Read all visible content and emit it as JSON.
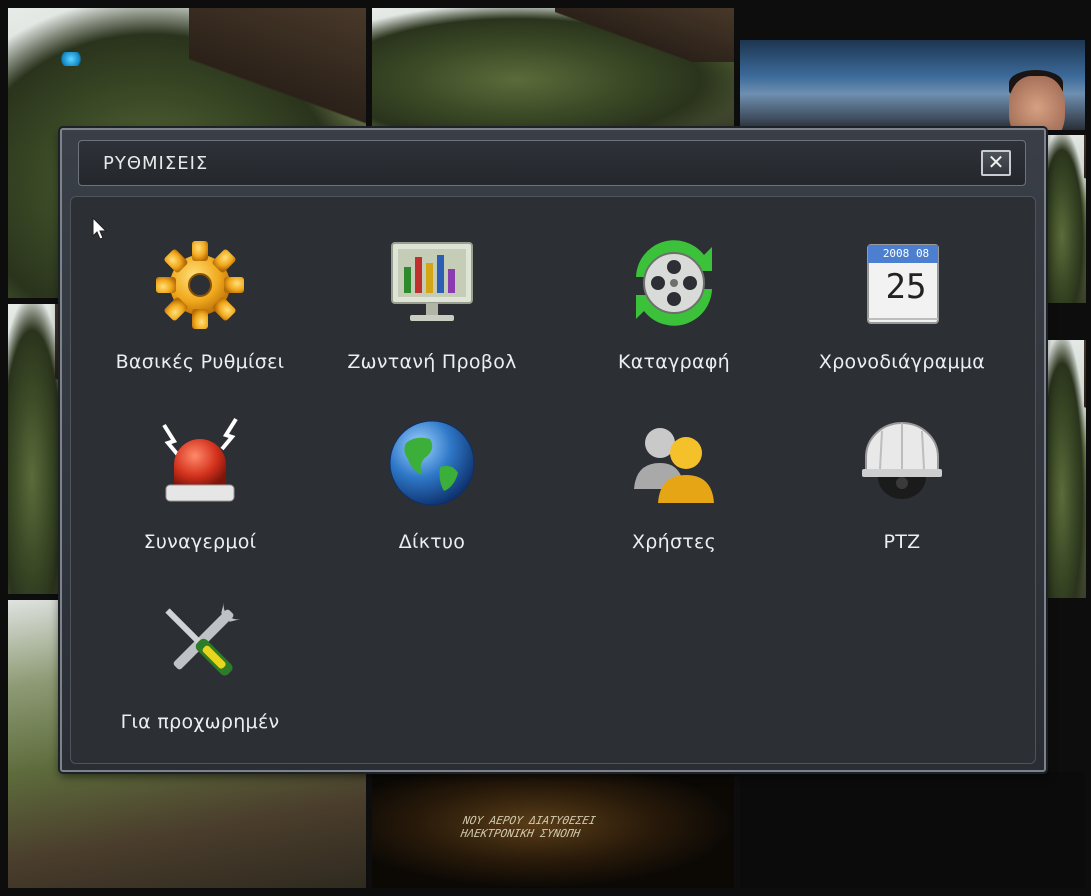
{
  "dialog": {
    "title": "ΡΥΘΜΙΣΕΙΣ",
    "close_label": "✕"
  },
  "menu": {
    "items": [
      {
        "label": "Βασικές Ρυθμίσει",
        "icon": "gear-icon"
      },
      {
        "label": "Ζωντανή Προβολ",
        "icon": "monitor-icon"
      },
      {
        "label": "Καταγραφή",
        "icon": "film-reel-icon"
      },
      {
        "label": "Χρονοδιάγραμμα",
        "icon": "calendar-icon"
      },
      {
        "label": "Συναγερμοί",
        "icon": "alarm-siren-icon"
      },
      {
        "label": "Δίκτυο",
        "icon": "globe-icon"
      },
      {
        "label": "Χρήστες",
        "icon": "users-icon"
      },
      {
        "label": "PTZ",
        "icon": "dome-camera-icon"
      },
      {
        "label": "Για προχωρημέν",
        "icon": "tools-icon"
      }
    ]
  },
  "calendar_icon": {
    "year": "2008",
    "month": "08",
    "day": "25"
  },
  "background": {
    "sign_text_line1": "ΝΟΥ ΑΕΡΟΥ ΔΙΑΤΥΘΕΣΕΙ",
    "sign_text_line2": "ΗΛΕΚΤΡΟΝΙΚΗ ΣΥΝΟΠΗ"
  }
}
